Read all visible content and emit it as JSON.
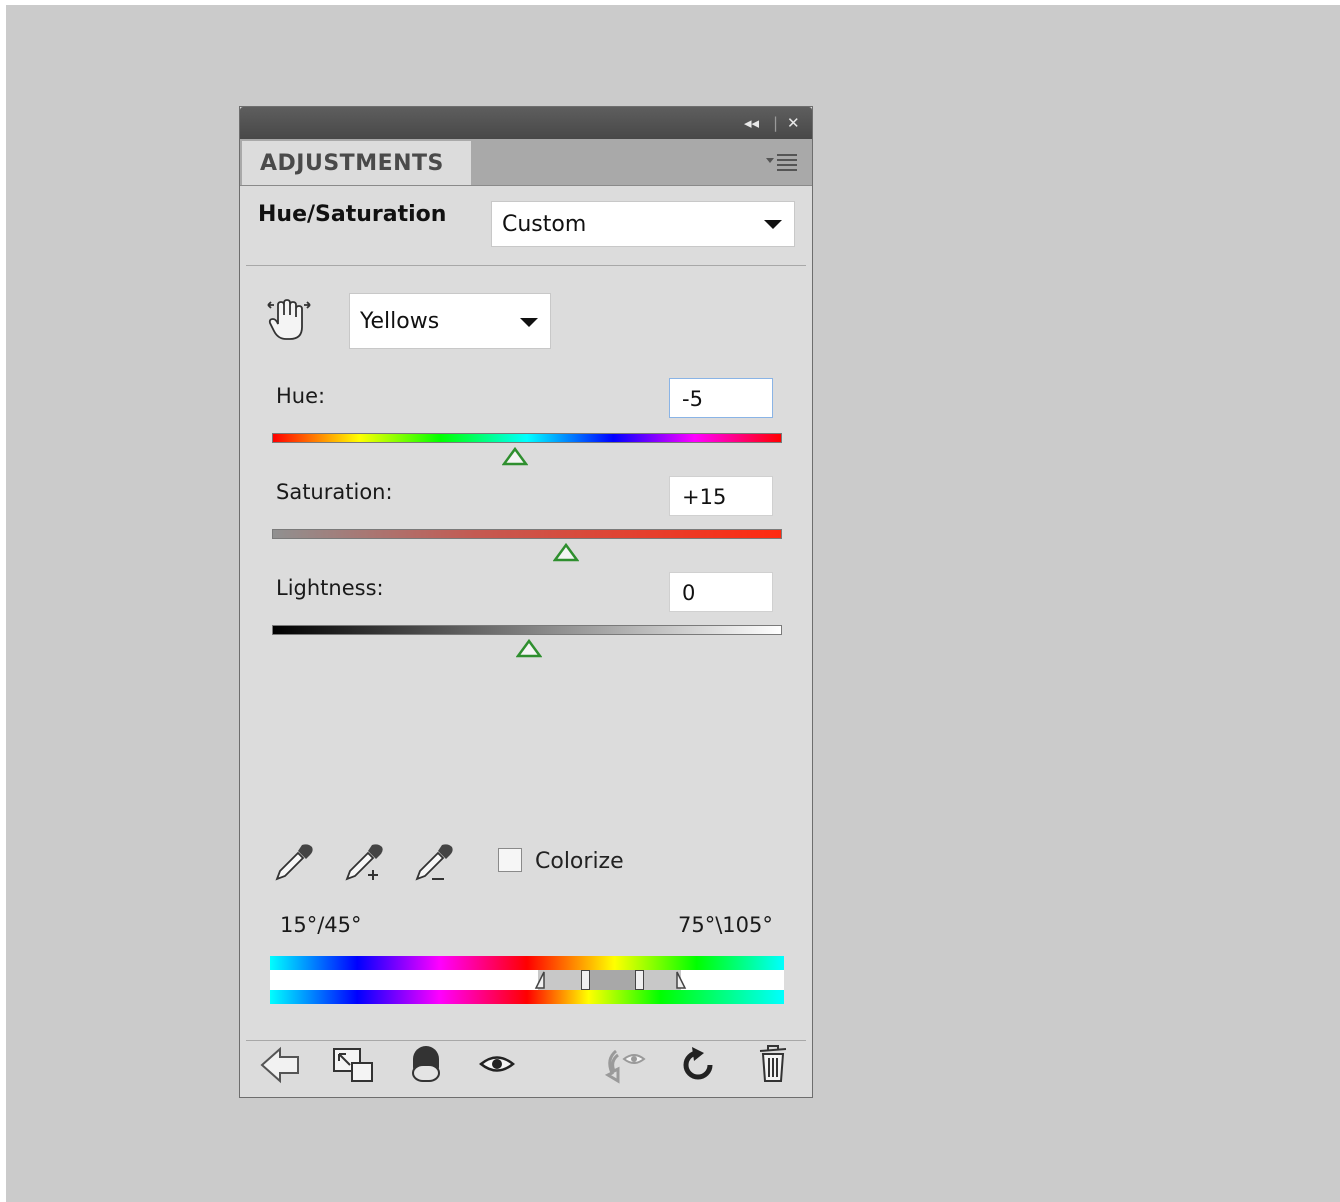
{
  "panel": {
    "tab_label": "ADJUSTMENTS",
    "title": "Hue/Saturation",
    "preset": {
      "value": "Custom"
    },
    "channel": {
      "value": "Yellows"
    },
    "hue": {
      "label": "Hue:",
      "value": "-5"
    },
    "saturation": {
      "label": "Saturation:",
      "value": "+15"
    },
    "lightness": {
      "label": "Lightness:",
      "value": "0"
    },
    "colorize": {
      "label": "Colorize",
      "checked": false
    },
    "range": {
      "left": "15°/45°",
      "right": "75°\\105°"
    }
  },
  "icons": {
    "collapse": "double-chevron-left-icon",
    "close": "close-icon",
    "menu": "panel-menu-icon",
    "targeted_adjust": "hand-adjust-icon",
    "eyedropper": "eyedropper-icon",
    "eyedropper_add": "eyedropper-plus-icon",
    "eyedropper_subtract": "eyedropper-minus-icon",
    "back": "back-arrow-icon",
    "expand": "expand-view-icon",
    "clip": "clip-to-layer-icon",
    "visibility": "eye-icon",
    "previous_state": "previous-state-icon",
    "reset": "reset-icon",
    "delete": "trash-icon"
  },
  "colors": {
    "background": "#cbcbcb",
    "panel": "#dcdcdc",
    "titlebar": "#4f4f4f",
    "slider_thumb": "#3c9c3c"
  }
}
